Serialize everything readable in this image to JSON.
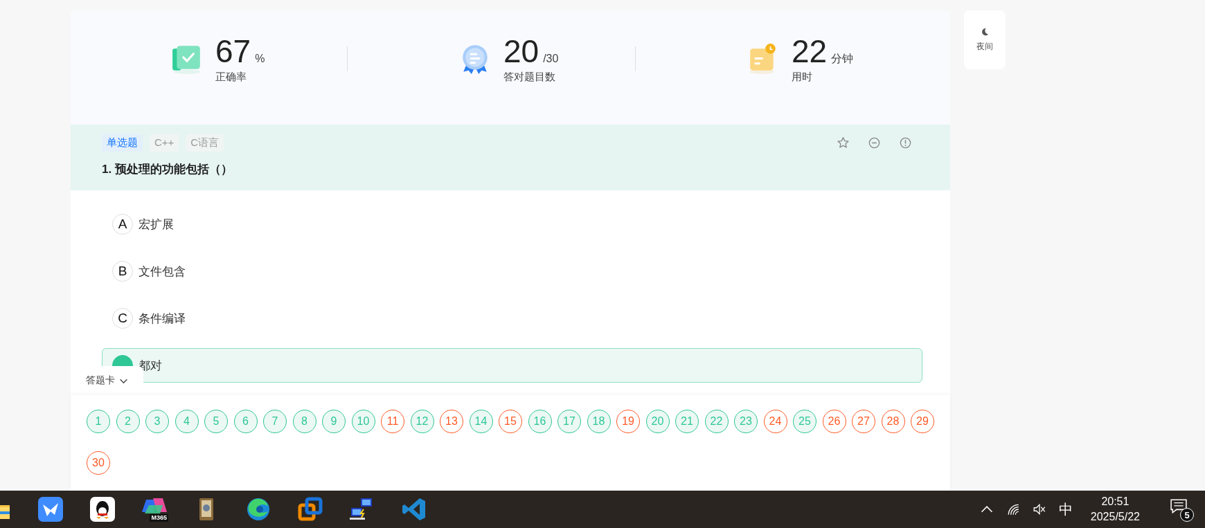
{
  "stats": [
    {
      "kind": "accuracy",
      "value": "67",
      "unit": "%",
      "label": "正确率"
    },
    {
      "kind": "correct",
      "value": "20",
      "unit": "/30",
      "label": "答对题目数"
    },
    {
      "kind": "time",
      "value": "22",
      "unit": "分钟",
      "label": "用时"
    }
  ],
  "night_button": {
    "label": "夜间"
  },
  "question": {
    "tags": [
      {
        "label": "单选题",
        "kind": "type"
      },
      {
        "label": "C++",
        "kind": "topic"
      },
      {
        "label": "C语言",
        "kind": "topic"
      }
    ],
    "text": "1. 预处理的功能包括（）",
    "options": [
      {
        "letter": "A",
        "text": "宏扩展",
        "selected": false
      },
      {
        "letter": "B",
        "text": "文件包含",
        "selected": false
      },
      {
        "letter": "C",
        "text": "条件编译",
        "selected": false
      },
      {
        "text": "都对",
        "selected": true
      }
    ]
  },
  "answer_card": {
    "title": "答题卡",
    "items": [
      {
        "number": "1",
        "correct": true
      },
      {
        "number": "2",
        "correct": true
      },
      {
        "number": "3",
        "correct": true
      },
      {
        "number": "4",
        "correct": true
      },
      {
        "number": "5",
        "correct": true
      },
      {
        "number": "6",
        "correct": true
      },
      {
        "number": "7",
        "correct": true
      },
      {
        "number": "8",
        "correct": true
      },
      {
        "number": "9",
        "correct": true
      },
      {
        "number": "10",
        "correct": true
      },
      {
        "number": "11",
        "correct": false
      },
      {
        "number": "12",
        "correct": true
      },
      {
        "number": "13",
        "correct": false
      },
      {
        "number": "14",
        "correct": true
      },
      {
        "number": "15",
        "correct": false
      },
      {
        "number": "16",
        "correct": true
      },
      {
        "number": "17",
        "correct": true
      },
      {
        "number": "18",
        "correct": true
      },
      {
        "number": "19",
        "correct": false
      },
      {
        "number": "20",
        "correct": true
      },
      {
        "number": "21",
        "correct": true
      },
      {
        "number": "22",
        "correct": true
      },
      {
        "number": "23",
        "correct": true
      },
      {
        "number": "24",
        "correct": false
      },
      {
        "number": "25",
        "correct": true
      },
      {
        "number": "26",
        "correct": false
      },
      {
        "number": "27",
        "correct": false
      },
      {
        "number": "28",
        "correct": false
      },
      {
        "number": "29",
        "correct": false
      },
      {
        "number": "30",
        "correct": false
      }
    ]
  },
  "taskbar": {
    "apps": [
      {
        "kind": "folder"
      },
      {
        "kind": "bird"
      },
      {
        "kind": "penguin"
      },
      {
        "kind": "m365",
        "label": "M365"
      },
      {
        "kind": "viewer"
      },
      {
        "kind": "edge"
      },
      {
        "kind": "squares"
      },
      {
        "kind": "network"
      },
      {
        "kind": "vscode"
      }
    ],
    "ime": "中",
    "time": "20:51",
    "date": "2025/5/22",
    "notifications": "5"
  }
}
